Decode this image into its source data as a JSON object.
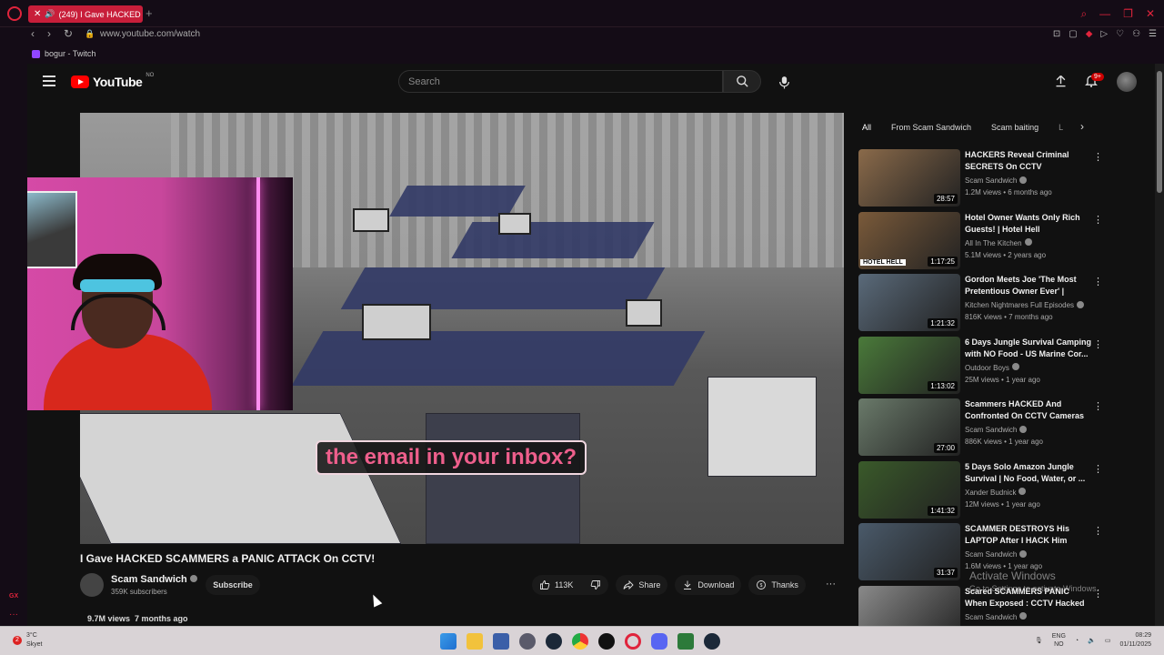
{
  "browser": {
    "tab_title": "(249) I Gave HACKED",
    "new_tab": "+",
    "url": "www.youtube.com/watch",
    "bookmark": "bogur - Twitch",
    "gx_label": "GX"
  },
  "youtube": {
    "logo_text": "YouTube",
    "country_code": "NO",
    "search_placeholder": "Search",
    "notification_count": "9+",
    "video": {
      "caption": "the email in your inbox?",
      "title": "I Gave HACKED SCAMMERS a PANIC ATTACK On CCTV!",
      "channel": "Scam Sandwich",
      "subscribers": "359K subscribers",
      "subscribe_label": "Subscribe",
      "likes": "113K",
      "share_label": "Share",
      "download_label": "Download",
      "thanks_label": "Thanks",
      "views": "9.7M views",
      "age": "7 months ago"
    },
    "chips": [
      {
        "label": "All"
      },
      {
        "label": "From Scam Sandwich"
      },
      {
        "label": "Scam baiting"
      },
      {
        "label": "L"
      }
    ],
    "recommendations": [
      {
        "title": "HACKERS Reveal Criminal SECRETS On CCTV",
        "channel": "Scam Sandwich",
        "meta": "1.2M views • 6 months ago",
        "duration": "28:57",
        "badge": "",
        "thumb_color": "#8a6a4a"
      },
      {
        "title": "Hotel Owner Wants Only Rich Guests! | Hotel Hell",
        "channel": "All In The Kitchen",
        "meta": "5.1M views • 2 years ago",
        "duration": "1:17:25",
        "badge": "HOTEL HELL",
        "thumb_color": "#7a5a3a"
      },
      {
        "title": "Gordon Meets Joe 'The Most Pretentious Owner Ever' | FULL...",
        "channel": "Kitchen Nightmares Full Episodes",
        "meta": "816K views • 7 months ago",
        "duration": "1:21:32",
        "badge": "",
        "thumb_color": "#5a6a7a"
      },
      {
        "title": "6 Days Jungle Survival Camping with NO Food - US Marine Cor...",
        "channel": "Outdoor Boys",
        "meta": "25M views • 1 year ago",
        "duration": "1:13:02",
        "badge": "",
        "thumb_color": "#4a7a3a"
      },
      {
        "title": "Scammers HACKED And Confronted On CCTV Cameras",
        "channel": "Scam Sandwich",
        "meta": "886K views • 1 year ago",
        "duration": "27:00",
        "badge": "",
        "thumb_color": "#6a7a6a"
      },
      {
        "title": "5 Days Solo Amazon Jungle Survival | No Food, Water, or ...",
        "channel": "Xander Budnick",
        "meta": "12M views • 1 year ago",
        "duration": "1:41:32",
        "badge": "",
        "thumb_color": "#3a5a2a"
      },
      {
        "title": "SCAMMER DESTROYS His LAPTOP After I HACK Him",
        "channel": "Scam Sandwich",
        "meta": "1.6M views • 1 year ago",
        "duration": "31:37",
        "badge": "",
        "thumb_color": "#4a5a6a"
      },
      {
        "title": "Scared SCAMMERS PANIC When Exposed : CCTV Hacked",
        "channel": "Scam Sandwich",
        "meta": "",
        "duration": "",
        "badge": "",
        "thumb_color": "#8a8a8a"
      }
    ]
  },
  "windows": {
    "activate_title": "Activate Windows",
    "activate_sub": "Go to Settings to activate Windows."
  },
  "taskbar": {
    "weather_badge": "2",
    "temperature": "3°C",
    "weather_desc": "Skyet",
    "lang_1": "ENG",
    "lang_2": "NO",
    "time": "08:29",
    "date": "01/11/2025"
  }
}
